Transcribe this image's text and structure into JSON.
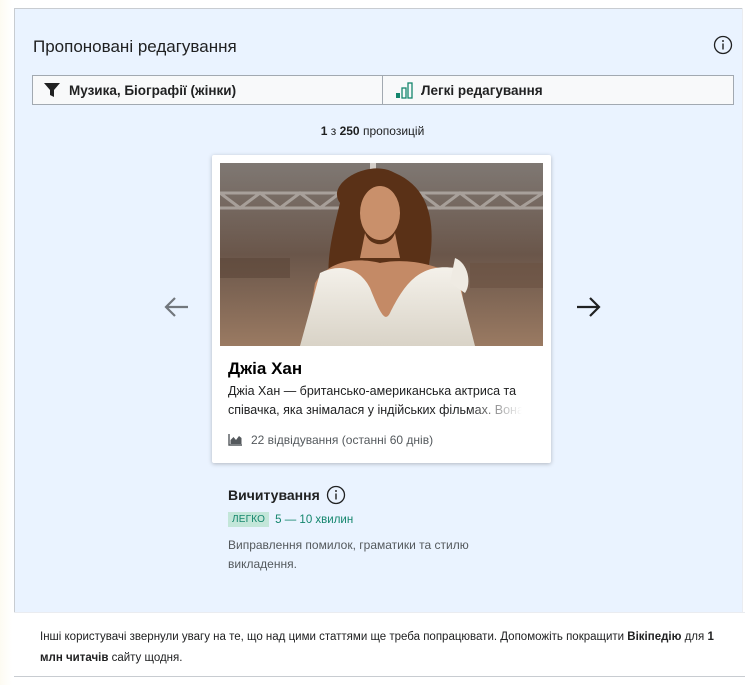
{
  "header": {
    "title": "Пропоновані редагування"
  },
  "filters": {
    "topics_label": "Музика, Біографії (жінки)",
    "difficulty_label": "Легкі редагування"
  },
  "counter": {
    "current": "1",
    "separator": " з ",
    "total": "250",
    "suffix": " пропозицій"
  },
  "card": {
    "title": "Джіа Хан",
    "extract": "Джіа Хан — британсько-американська актриса та співачка, яка знімалася у індійських фільмах. Вона",
    "views": "22 відвідування (останні 60 днів)"
  },
  "task": {
    "title": "Вичитування",
    "difficulty_badge": "ЛЕГКО",
    "time_estimate": "5 — 10 хвилин",
    "description": "Виправлення помилок, граматики та стилю викладення."
  },
  "footer": {
    "part1": "Інші користувачі звернули увагу на те, що над цими статтями ще треба попрацювати. Допоможіть покращити ",
    "bold1": "Вікіпедію",
    "part2": " для ",
    "bold2": "1 млн читачів",
    "part3": " сайту щодня."
  },
  "colors": {
    "panel_bg": "#eaf3ff",
    "accent_green": "#14866d",
    "badge_bg": "#c3e6d9"
  },
  "icons": [
    "info-icon",
    "filter-icon",
    "difficulty-bars-icon",
    "arrow-left-icon",
    "arrow-right-icon",
    "chart-icon"
  ]
}
